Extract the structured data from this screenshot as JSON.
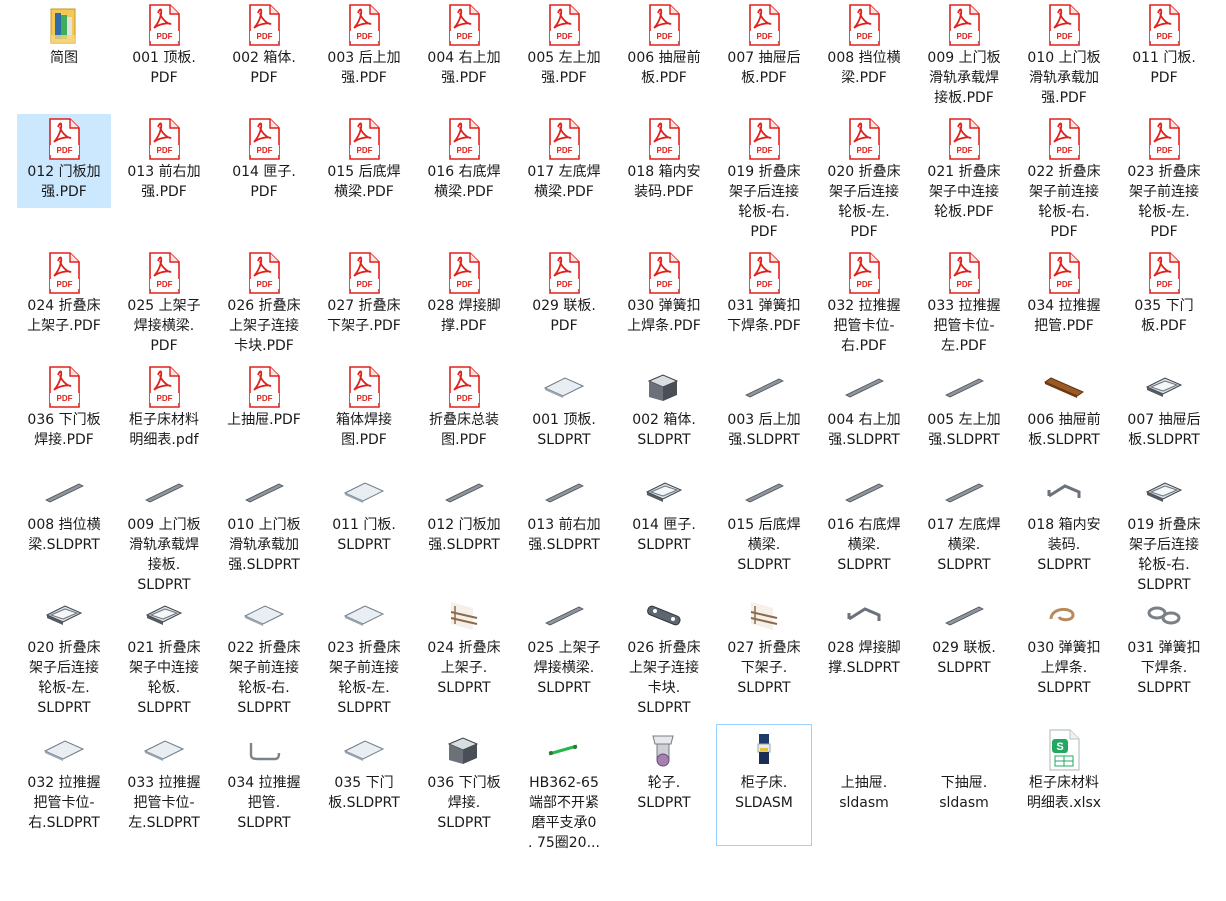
{
  "colors": {
    "selection": "#cce8ff",
    "pdf_red": "#e0201b",
    "folder": "#f4c757",
    "xlsx_green": "#22a860"
  },
  "files": [
    {
      "label": "简图",
      "icon": "folder-icon"
    },
    {
      "label": "001 顶板.\nPDF",
      "icon": "pdf-icon"
    },
    {
      "label": "002 箱体.\nPDF",
      "icon": "pdf-icon"
    },
    {
      "label": "003 后上加\n强.PDF",
      "icon": "pdf-icon"
    },
    {
      "label": "004 右上加\n强.PDF",
      "icon": "pdf-icon"
    },
    {
      "label": "005 左上加\n强.PDF",
      "icon": "pdf-icon"
    },
    {
      "label": "006 抽屉前\n板.PDF",
      "icon": "pdf-icon"
    },
    {
      "label": "007 抽屉后\n板.PDF",
      "icon": "pdf-icon"
    },
    {
      "label": "008 挡位横\n梁.PDF",
      "icon": "pdf-icon"
    },
    {
      "label": "009 上门板\n滑轨承载焊\n接板.PDF",
      "icon": "pdf-icon"
    },
    {
      "label": "010 上门板\n滑轨承载加\n强.PDF",
      "icon": "pdf-icon"
    },
    {
      "label": "011 门板.\nPDF",
      "icon": "pdf-icon"
    },
    {
      "label": "012 门板加\n强.PDF",
      "icon": "pdf-icon",
      "selected": true
    },
    {
      "label": "013 前右加\n强.PDF",
      "icon": "pdf-icon"
    },
    {
      "label": "014 匣子.\nPDF",
      "icon": "pdf-icon"
    },
    {
      "label": "015 后底焊\n横梁.PDF",
      "icon": "pdf-icon"
    },
    {
      "label": "016 右底焊\n横梁.PDF",
      "icon": "pdf-icon"
    },
    {
      "label": "017 左底焊\n横梁.PDF",
      "icon": "pdf-icon"
    },
    {
      "label": "018 箱内安\n装码.PDF",
      "icon": "pdf-icon"
    },
    {
      "label": "019 折叠床\n架子后连接\n轮板-右.\nPDF",
      "icon": "pdf-icon"
    },
    {
      "label": "020 折叠床\n架子后连接\n轮板-左.\nPDF",
      "icon": "pdf-icon"
    },
    {
      "label": "021 折叠床\n架子中连接\n轮板.PDF",
      "icon": "pdf-icon"
    },
    {
      "label": "022 折叠床\n架子前连接\n轮板-右.\nPDF",
      "icon": "pdf-icon"
    },
    {
      "label": "023 折叠床\n架子前连接\n轮板-左.\nPDF",
      "icon": "pdf-icon"
    },
    {
      "label": "024 折叠床\n上架子.PDF",
      "icon": "pdf-icon"
    },
    {
      "label": "025 上架子\n焊接横梁.\nPDF",
      "icon": "pdf-icon"
    },
    {
      "label": "026 折叠床\n上架子连接\n卡块.PDF",
      "icon": "pdf-icon"
    },
    {
      "label": "027 折叠床\n下架子.PDF",
      "icon": "pdf-icon"
    },
    {
      "label": "028 焊接脚\n撑.PDF",
      "icon": "pdf-icon"
    },
    {
      "label": "029 联板.\nPDF",
      "icon": "pdf-icon"
    },
    {
      "label": "030 弹簧扣\n上焊条.PDF",
      "icon": "pdf-icon"
    },
    {
      "label": "031 弹簧扣\n下焊条.PDF",
      "icon": "pdf-icon"
    },
    {
      "label": "032 拉推握\n把管卡位-\n右.PDF",
      "icon": "pdf-icon"
    },
    {
      "label": "033 拉推握\n把管卡位-\n左.PDF",
      "icon": "pdf-icon"
    },
    {
      "label": "034 拉推握\n把管.PDF",
      "icon": "pdf-icon"
    },
    {
      "label": "035 下门\n板.PDF",
      "icon": "pdf-icon"
    },
    {
      "label": "036 下门板\n焊接.PDF",
      "icon": "pdf-icon"
    },
    {
      "label": "柜子床材料\n明细表.pdf",
      "icon": "pdf-icon"
    },
    {
      "label": "上抽屉.PDF",
      "icon": "pdf-icon"
    },
    {
      "label": "箱体焊接\n图.PDF",
      "icon": "pdf-icon"
    },
    {
      "label": "折叠床总装\n图.PDF",
      "icon": "pdf-icon"
    },
    {
      "label": "001 顶板.\nSLDPRT",
      "icon": "flat-plate-icon"
    },
    {
      "label": "002 箱体.\nSLDPRT",
      "icon": "box-frame-icon"
    },
    {
      "label": "003 后上加\n强.SLDPRT",
      "icon": "bar-icon"
    },
    {
      "label": "004 右上加\n强.SLDPRT",
      "icon": "bar-icon"
    },
    {
      "label": "005 左上加\n强.SLDPRT",
      "icon": "bar-icon"
    },
    {
      "label": "006 抽屉前\n板.SLDPRT",
      "icon": "wood-board-icon"
    },
    {
      "label": "007 抽屉后\n板.SLDPRT",
      "icon": "tray-icon"
    },
    {
      "label": "008 挡位横\n梁.SLDPRT",
      "icon": "bar-icon"
    },
    {
      "label": "009 上门板\n滑轨承载焊\n接板.\nSLDPRT",
      "icon": "bar-icon"
    },
    {
      "label": "010 上门板\n滑轨承载加\n强.SLDPRT",
      "icon": "bar-icon"
    },
    {
      "label": "011 门板.\nSLDPRT",
      "icon": "flat-plate-icon"
    },
    {
      "label": "012 门板加\n强.SLDPRT",
      "icon": "bar-icon"
    },
    {
      "label": "013 前右加\n强.SLDPRT",
      "icon": "bar-icon"
    },
    {
      "label": "014 匣子.\nSLDPRT",
      "icon": "tray-icon"
    },
    {
      "label": "015 后底焊\n横梁.\nSLDPRT",
      "icon": "bar-icon"
    },
    {
      "label": "016 右底焊\n横梁.\nSLDPRT",
      "icon": "bar-icon"
    },
    {
      "label": "017 左底焊\n横梁.\nSLDPRT",
      "icon": "bar-icon"
    },
    {
      "label": "018 箱内安\n装码.\nSLDPRT",
      "icon": "bracket-icon"
    },
    {
      "label": "019 折叠床\n架子后连接\n轮板-右.\nSLDPRT",
      "icon": "tray-icon"
    },
    {
      "label": "020 折叠床\n架子后连接\n轮板-左.\nSLDPRT",
      "icon": "tray-icon"
    },
    {
      "label": "021 折叠床\n架子中连接\n轮板.\nSLDPRT",
      "icon": "tray-icon"
    },
    {
      "label": "022 折叠床\n架子前连接\n轮板-右.\nSLDPRT",
      "icon": "flat-plate-icon"
    },
    {
      "label": "023 折叠床\n架子前连接\n轮板-左.\nSLDPRT",
      "icon": "flat-plate-icon"
    },
    {
      "label": "024 折叠床\n上架子.\nSLDPRT",
      "icon": "frame-icon"
    },
    {
      "label": "025 上架子\n焊接横梁.\nSLDPRT",
      "icon": "bar-icon"
    },
    {
      "label": "026 折叠床\n上架子连接\n卡块.\nSLDPRT",
      "icon": "link-plate-icon"
    },
    {
      "label": "027 折叠床\n下架子.\nSLDPRT",
      "icon": "frame-icon"
    },
    {
      "label": "028 焊接脚\n撑.SLDPRT",
      "icon": "bracket-icon"
    },
    {
      "label": "029 联板.\nSLDPRT",
      "icon": "bar-icon"
    },
    {
      "label": "030 弹簧扣\n上焊条.\nSLDPRT",
      "icon": "hook-icon"
    },
    {
      "label": "031 弹簧扣\n下焊条.\nSLDPRT",
      "icon": "chain-icon"
    },
    {
      "label": "032 拉推握\n把管卡位-\n右.SLDPRT",
      "icon": "flat-plate-icon"
    },
    {
      "label": "033 拉推握\n把管卡位-\n左.SLDPRT",
      "icon": "flat-plate-icon"
    },
    {
      "label": "034 拉推握\n把管.\nSLDPRT",
      "icon": "handle-icon"
    },
    {
      "label": "035 下门\n板.SLDPRT",
      "icon": "flat-plate-icon"
    },
    {
      "label": "036 下门板\n焊接.\nSLDPRT",
      "icon": "box-frame-icon"
    },
    {
      "label": "HB362-65\n端部不开紧\n磨平支承0\n. 75圈20...",
      "icon": "spring-icon"
    },
    {
      "label": "轮子.\nSLDPRT",
      "icon": "wheel-icon"
    },
    {
      "label": "柜子床.\nSLDASM",
      "icon": "assembly-icon",
      "focused": true
    },
    {
      "label": "上抽屉.\nsldasm",
      "icon": "blank-icon"
    },
    {
      "label": "下抽屉.\nsldasm",
      "icon": "blank-icon"
    },
    {
      "label": "柜子床材料\n明细表.xlsx",
      "icon": "xlsx-icon"
    }
  ]
}
